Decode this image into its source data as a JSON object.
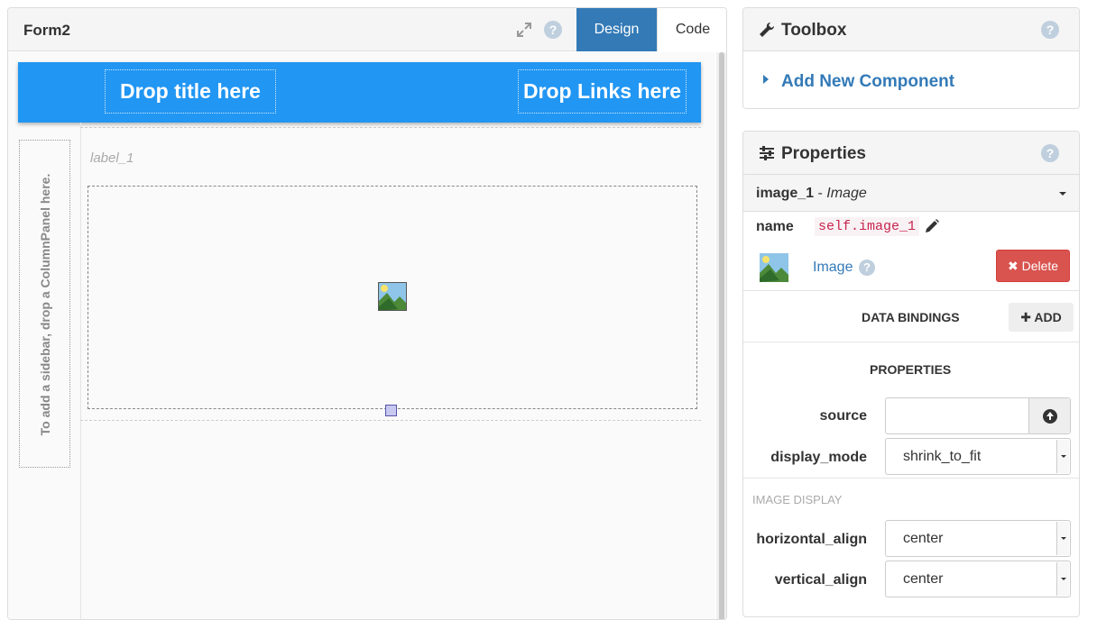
{
  "editor": {
    "form_title": "Form2",
    "tabs": {
      "design": "Design",
      "code": "Code"
    },
    "help": "?",
    "canvas": {
      "drop_title": "Drop title here",
      "drop_links": "Drop Links here",
      "sidebar_hint": "To add a sidebar, drop a ColumnPanel here.",
      "label": "label_1"
    }
  },
  "toolbox": {
    "title": "Toolbox",
    "help": "?",
    "add_component": "Add New Component"
  },
  "properties": {
    "title": "Properties",
    "help": "?",
    "component": {
      "name": "image_1",
      "separator": " - ",
      "type": "Image"
    },
    "name_label": "name",
    "name_value": "self.image_1",
    "type_link": "Image",
    "type_help": "?",
    "delete_label": "Delete",
    "data_bindings_title": "DATA BINDINGS",
    "add_label": "ADD",
    "properties_title": "PROPERTIES",
    "fields": {
      "source_label": "source",
      "source_value": "",
      "display_mode_label": "display_mode",
      "display_mode_value": "shrink_to_fit"
    },
    "image_display_caption": "IMAGE DISPLAY",
    "align": {
      "horizontal_label": "horizontal_align",
      "horizontal_value": "center",
      "vertical_label": "vertical_align",
      "vertical_value": "center"
    }
  },
  "colors": {
    "appbar": "#2196f3",
    "design_tab": "#337ab7",
    "link": "#337ab7",
    "delete": "#d9534f",
    "code_highlight": "#c7254e"
  }
}
